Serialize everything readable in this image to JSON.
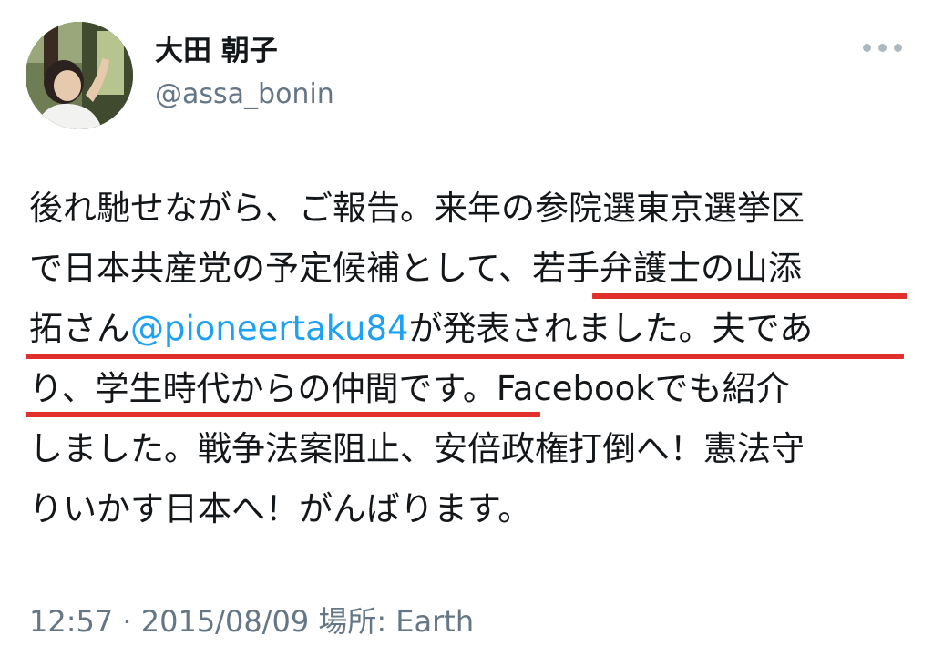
{
  "user": {
    "display_name": "大田 朝子",
    "handle": "@assa_bonin",
    "avatar_icon": "profile-photo"
  },
  "more_icon": "ellipsis-icon",
  "tweet": {
    "line1": "後れ馳せながら、ご報告。来年の参院選東京選挙区",
    "line2": "で日本共産党の予定候補として、若手弁護士の山添",
    "line3_pre": "拓さん",
    "mention": "@pioneertaku84",
    "line3_post": "が発表されました。夫であ",
    "line4": "り、学生時代からの仲間です。Facebookでも紹介",
    "line5": "しました。戦争法案阻止、安倍政権打倒へ！憲法守",
    "line6": "りいかす日本へ！がんばります。"
  },
  "meta": {
    "time_location": "12:57 · 2015/08/09 場所: Earth"
  },
  "colors": {
    "text": "#14171a",
    "secondary": "#657786",
    "mention": "#1da1f2",
    "highlight_underline": "#e0302b"
  }
}
